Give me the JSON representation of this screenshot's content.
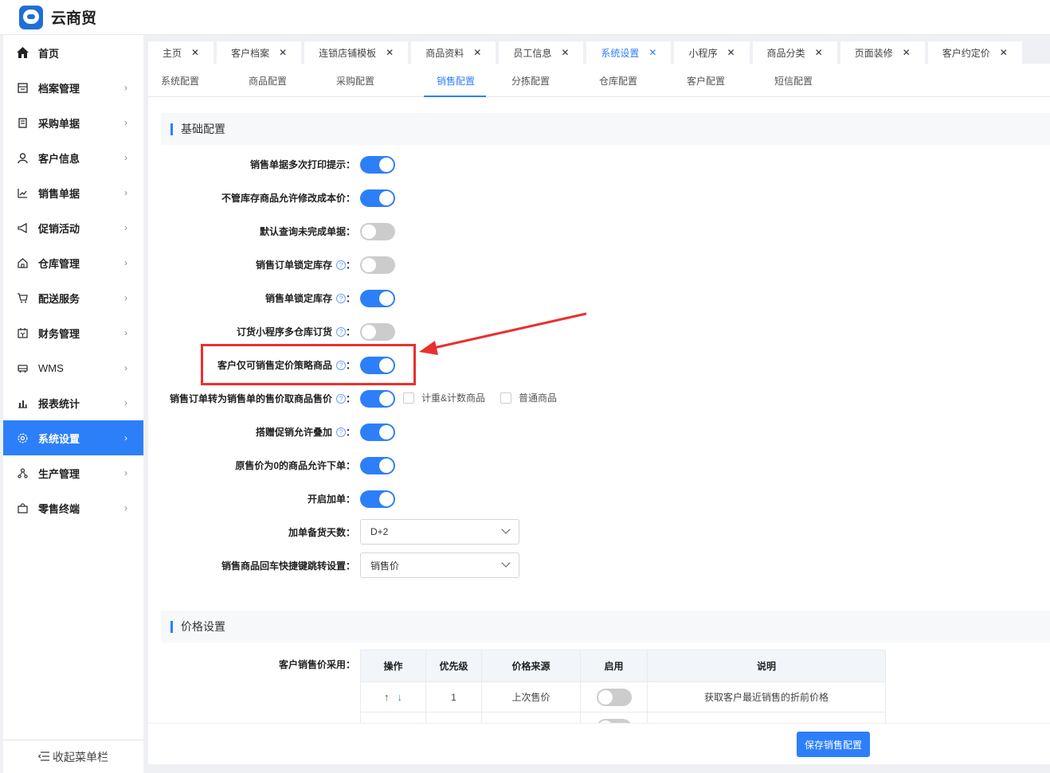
{
  "app": {
    "title": "云商贸",
    "logo_text": "云商"
  },
  "sidebar": {
    "items": [
      {
        "label": "首页",
        "icon": "home-icon"
      },
      {
        "label": "档案管理",
        "icon": "archive-icon"
      },
      {
        "label": "采购单据",
        "icon": "purchase-doc-icon"
      },
      {
        "label": "客户信息",
        "icon": "user-icon"
      },
      {
        "label": "销售单据",
        "icon": "chart-line-icon"
      },
      {
        "label": "促销活动",
        "icon": "megaphone-icon"
      },
      {
        "label": "仓库管理",
        "icon": "warehouse-icon"
      },
      {
        "label": "配送服务",
        "icon": "cart-icon"
      },
      {
        "label": "财务管理",
        "icon": "finance-icon"
      },
      {
        "label": "WMS",
        "icon": "truck-icon"
      },
      {
        "label": "报表统计",
        "icon": "bar-chart-icon"
      },
      {
        "label": "系统设置",
        "icon": "gear-icon"
      },
      {
        "label": "生产管理",
        "icon": "network-icon"
      },
      {
        "label": "零售终端",
        "icon": "bag-icon"
      }
    ],
    "active": "系统设置",
    "collapse_label": "收起菜单栏"
  },
  "tabs": [
    {
      "label": "主页"
    },
    {
      "label": "客户档案"
    },
    {
      "label": "连锁店铺模板"
    },
    {
      "label": "商品资料"
    },
    {
      "label": "员工信息"
    },
    {
      "label": "系统设置"
    },
    {
      "label": "小程序"
    },
    {
      "label": "商品分类"
    },
    {
      "label": "页面装修"
    },
    {
      "label": "客户约定价"
    }
  ],
  "active_tab": "系统设置",
  "subtabs": [
    {
      "label": "系统配置"
    },
    {
      "label": "商品配置"
    },
    {
      "label": "采购配置"
    },
    {
      "label": "销售配置"
    },
    {
      "label": "分拣配置"
    },
    {
      "label": "仓库配置"
    },
    {
      "label": "客户配置"
    },
    {
      "label": "短信配置"
    }
  ],
  "active_subtab": "销售配置",
  "basic": {
    "title": "基础配置",
    "rows": [
      {
        "label": "销售单据多次打印提示：",
        "on": true,
        "help": false
      },
      {
        "label": "不管库存商品允许修改成本价：",
        "on": true,
        "help": false
      },
      {
        "label": "默认查询未完成单据：",
        "on": false,
        "help": false
      },
      {
        "label": "销售订单锁定库存",
        "on": false,
        "help": true
      },
      {
        "label": "销售单锁定库存",
        "on": true,
        "help": true
      },
      {
        "label": "订货小程序多仓库订货",
        "on": false,
        "help": true
      },
      {
        "label": "客户仅可销售定价策略商品",
        "on": true,
        "help": true
      },
      {
        "label": "销售订单转为销售单的售价取商品售价",
        "on": true,
        "help": true
      },
      {
        "label": "搭赠促销允许叠加",
        "on": true,
        "help": true
      },
      {
        "label": "原售价为0的商品允许下单：",
        "on": true,
        "help": false
      },
      {
        "label": "开启加单：",
        "on": true,
        "help": false
      }
    ],
    "checkbox_1": "计重&计数商品",
    "checkbox_2": "普通商品",
    "select_1": {
      "label": "加单备货天数：",
      "value": "D+2"
    },
    "select_2": {
      "label": "销售商品回车快捷键跳转设置：",
      "value": "销售价"
    }
  },
  "price": {
    "title": "价格设置",
    "label": "客户销售价采用：",
    "columns": [
      "操作",
      "优先级",
      "价格来源",
      "启用",
      "说明"
    ],
    "rows": [
      {
        "priority": "1",
        "source": "上次售价",
        "enabled": false,
        "desc": "获取客户最近销售的折前价格"
      }
    ]
  },
  "save_button": "保存销售配置",
  "colors": {
    "accent": "#2d7ff9",
    "highlight": "#e8312f"
  }
}
